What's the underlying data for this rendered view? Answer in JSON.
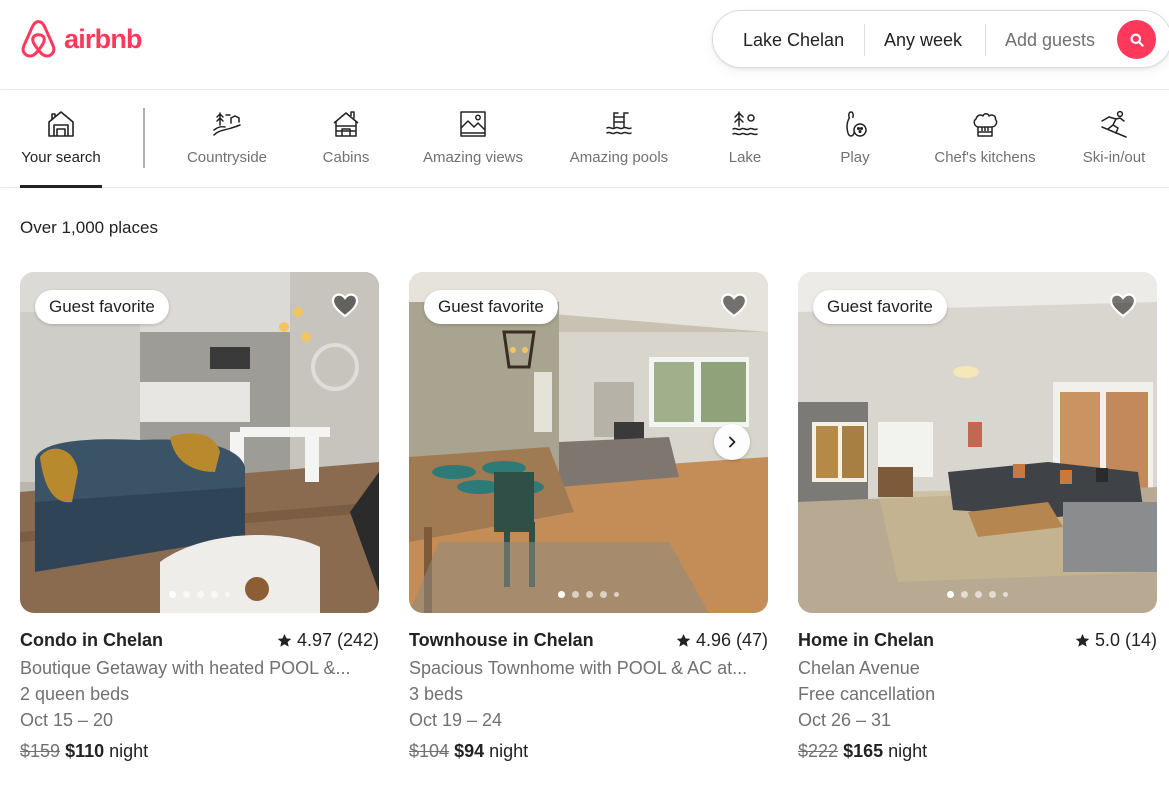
{
  "brand": {
    "name": "airbnb",
    "color": "#FF385C"
  },
  "search": {
    "where": "Lake Chelan",
    "when": "Any week",
    "who": "Add guests",
    "icon": "search-icon"
  },
  "categories": [
    {
      "label": "Your search",
      "icon": "home-search-icon",
      "active": true
    },
    {
      "label": "Countryside",
      "icon": "countryside-icon"
    },
    {
      "label": "Cabins",
      "icon": "cabin-icon"
    },
    {
      "label": "Amazing views",
      "icon": "view-icon"
    },
    {
      "label": "Amazing pools",
      "icon": "pool-icon"
    },
    {
      "label": "Lake",
      "icon": "lake-icon"
    },
    {
      "label": "Play",
      "icon": "bowling-icon"
    },
    {
      "label": "Chef's kitchens",
      "icon": "chef-hat-icon"
    },
    {
      "label": "Ski-in/out",
      "icon": "skier-icon"
    }
  ],
  "results": {
    "count_label": "Over 1,000 places"
  },
  "listings": [
    {
      "badge": "Guest favorite",
      "title": "Condo in Chelan",
      "rating": "4.97 (242)",
      "line1": "Boutique Getaway with heated POOL &...",
      "line2": "2 queen beds",
      "dates": "Oct 15 – 20",
      "old_price": "$159",
      "new_price": "$110",
      "price_unit": "night"
    },
    {
      "badge": "Guest favorite",
      "title": "Townhouse in Chelan",
      "rating": "4.96 (47)",
      "line1": "Spacious Townhome with POOL & AC at...",
      "line2": "3 beds",
      "dates": "Oct 19 – 24",
      "old_price": "$104",
      "new_price": "$94",
      "price_unit": "night"
    },
    {
      "badge": "Guest favorite",
      "title": "Home in Chelan",
      "rating": "5.0 (14)",
      "line1": "Chelan Avenue",
      "line2": "Free cancellation",
      "dates": "Oct 26 – 31",
      "old_price": "$222",
      "new_price": "$165",
      "price_unit": "night"
    }
  ]
}
